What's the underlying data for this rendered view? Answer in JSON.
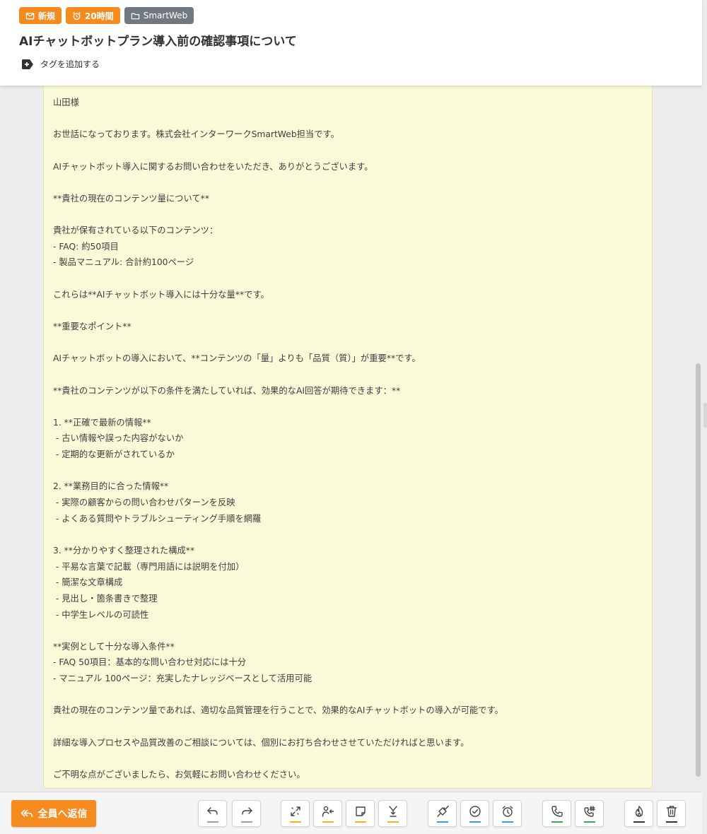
{
  "header": {
    "badges": [
      {
        "icon": "mail-check-icon",
        "label": "新規",
        "color": "#f58a1f"
      },
      {
        "icon": "alarm-clock-icon",
        "label": "20時間",
        "color": "#f58a1f"
      },
      {
        "icon": "folder-icon",
        "label": "SmartWeb",
        "color": "#727880"
      }
    ],
    "subject": "AIチャットボットプラン導入前の確認事項について",
    "add_tag_label": "タグを追加する",
    "add_tag_icon": "tag-plus-icon"
  },
  "email": {
    "background": "#fafad9",
    "lines": [
      "山田様",
      "",
      "お世話になっております。株式会社インターワークSmartWeb担当です。",
      "",
      "AIチャットボット導入に関するお問い合わせをいただき、ありがとうございます。",
      "",
      "**貴社の現在のコンテンツ量について**",
      "",
      "貴社が保有されている以下のコンテンツ：",
      "- FAQ: 約50項目",
      "- 製品マニュアル: 合計約100ページ",
      "",
      "これらは**AIチャットボット導入には十分な量**です。",
      "",
      "**重要なポイント**",
      "",
      "AIチャットボットの導入において、**コンテンツの「量」よりも「品質（質）」が重要**です。",
      "",
      "**貴社のコンテンツが以下の条件を満たしていれば、効果的なAI回答が期待できます：**",
      "",
      "1. **正確で最新の情報**",
      " - 古い情報や誤った内容がないか",
      " - 定期的な更新がされているか",
      "",
      "2. **業務目的に合った情報**",
      " - 実際の顧客からの問い合わせパターンを反映",
      " - よくある質問やトラブルシューティング手順を網羅",
      "",
      "3. **分かりやすく整理された構成**",
      " - 平易な言葉で記載（専門用語には説明を付加）",
      " - 簡潔な文章構成",
      " - 見出し・箇条書きで整理",
      " - 中学生レベルの可読性",
      "",
      "**実例として十分な導入条件**",
      "- FAQ 50項目：基本的な問い合わせ対応には十分",
      "- マニュアル 100ページ：充実したナレッジベースとして活用可能",
      "",
      "貴社の現在のコンテンツ量であれば、適切な品質管理を行うことで、効果的なAIチャットボットの導入が可能です。",
      "",
      "詳細な導入プロセスや品質改善のご相談については、個別にお打ち合わせさせていただければと思います。",
      "",
      "ご不明な点がございましたら、お気軽にお問い合わせください。"
    ]
  },
  "toolbar": {
    "reply_all_label": "全員へ返信",
    "reply_all_icon": "reply-all-icon",
    "reply_all_color": "#f58a1f",
    "buttons": [
      {
        "name": "reply-button",
        "icon": "reply-icon",
        "accent": "#9e9e9e"
      },
      {
        "name": "forward-button",
        "icon": "forward-icon",
        "accent": "#9e9e9e"
      },
      {
        "name": "merge-button",
        "icon": "merge-arrows-icon",
        "accent": "#f5b324"
      },
      {
        "name": "assign-user-button",
        "icon": "user-assign-icon",
        "accent": "#f5b324"
      },
      {
        "name": "note-button",
        "icon": "sticky-note-icon",
        "accent": "#f5b324"
      },
      {
        "name": "download-button",
        "icon": "download-merge-icon",
        "accent": "#f5b324"
      },
      {
        "name": "resolve-button",
        "icon": "flag-check-icon",
        "accent": "#3b9bd9"
      },
      {
        "name": "complete-button",
        "icon": "check-circle-icon",
        "accent": "#3b9bd9"
      },
      {
        "name": "reminder-button",
        "icon": "alarm-clock-icon",
        "accent": "#3b9bd9"
      },
      {
        "name": "call-button",
        "icon": "phone-icon",
        "accent": "#3aa845"
      },
      {
        "name": "call-number-button",
        "icon": "phone-hash-icon",
        "accent": "#3aa845"
      },
      {
        "name": "spam-button",
        "icon": "flame-icon",
        "accent": "#333333"
      },
      {
        "name": "delete-button",
        "icon": "trash-icon",
        "accent": "#333333"
      }
    ]
  }
}
